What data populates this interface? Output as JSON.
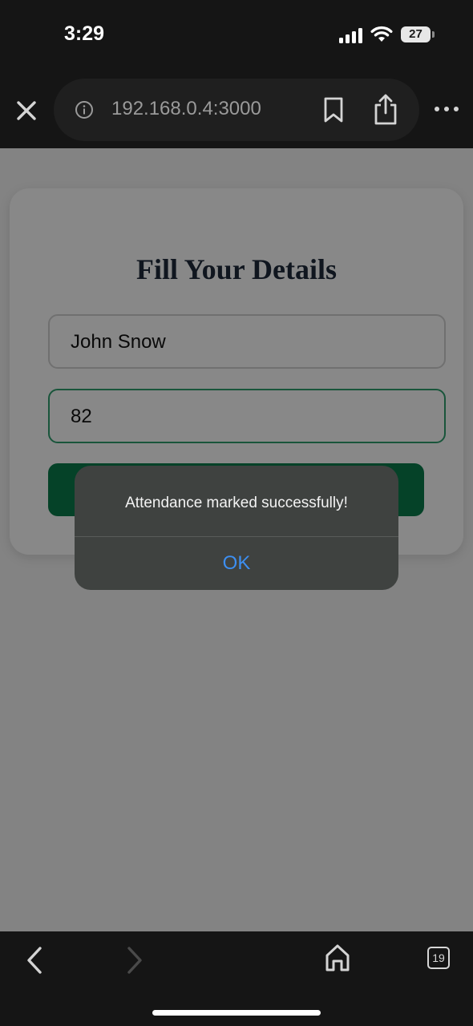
{
  "status_bar": {
    "time": "3:29",
    "battery": "27",
    "icons": [
      "signal-icon",
      "wifi-icon",
      "battery-icon"
    ]
  },
  "browser": {
    "url": "192.168.0.4:3000",
    "icons": [
      "close-icon",
      "info-icon",
      "bookmark-icon",
      "share-icon",
      "more-icon"
    ],
    "tab_count": "19"
  },
  "form": {
    "title": "Fill Your Details",
    "name_value": "John Snow",
    "roll_value": "82",
    "submit_color": "#0a7a4b"
  },
  "alert": {
    "message": "Attendance marked successfully!",
    "ok_label": "OK",
    "ok_color": "#3d8ff1"
  },
  "bottom_bar": {
    "icons": [
      "back-icon",
      "forward-icon",
      "home-icon",
      "tabs-icon"
    ]
  }
}
